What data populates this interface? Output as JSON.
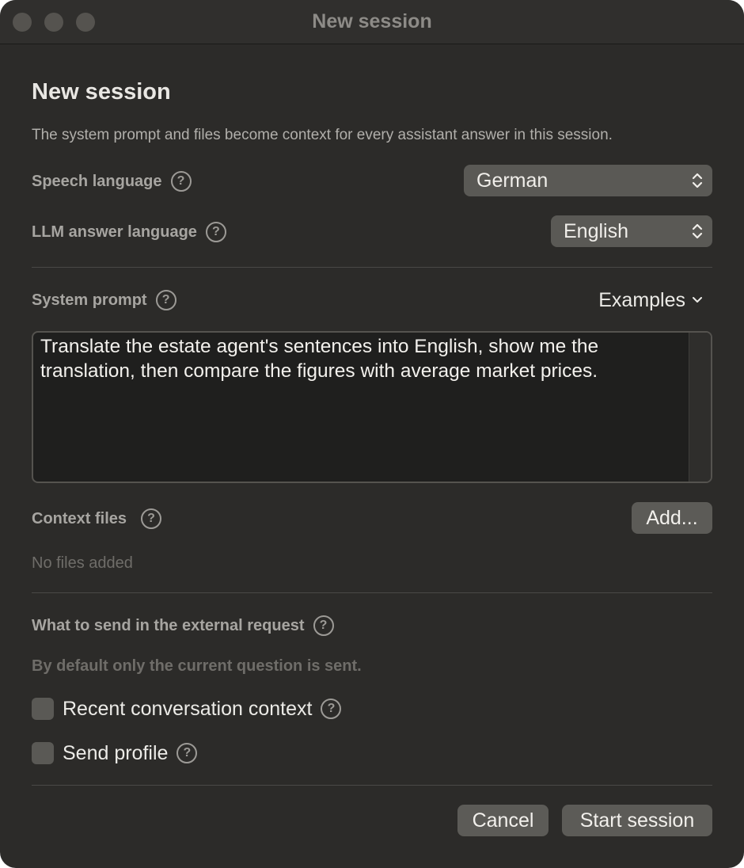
{
  "window": {
    "title": "New session"
  },
  "dialog": {
    "heading": "New session",
    "subtitle": "The system prompt and files become context for every assistant answer in this session."
  },
  "speech_language": {
    "label": "Speech language",
    "value": "German"
  },
  "llm_language": {
    "label": "LLM answer language",
    "value": "English"
  },
  "system_prompt": {
    "label": "System prompt",
    "examples_label": "Examples",
    "text": "Translate the estate agent's sentences into English, show me the translation, then compare the figures with average market prices."
  },
  "context_files": {
    "label": "Context files",
    "add_label": "Add...",
    "empty_text": "No files added"
  },
  "external_request": {
    "label": "What to send in the external request",
    "hint": "By default only the current question is sent.",
    "options": [
      {
        "label": "Recent conversation context",
        "checked": false
      },
      {
        "label": "Send profile",
        "checked": false
      }
    ]
  },
  "footer": {
    "cancel_label": "Cancel",
    "start_label": "Start session"
  },
  "icons": {
    "help": "?"
  },
  "colors": {
    "window_bg": "#2c2b29",
    "control_bg": "#5a5955",
    "text_primary": "#ecebe7",
    "text_secondary": "#a7a5a1",
    "text_muted": "#6f6d69"
  }
}
